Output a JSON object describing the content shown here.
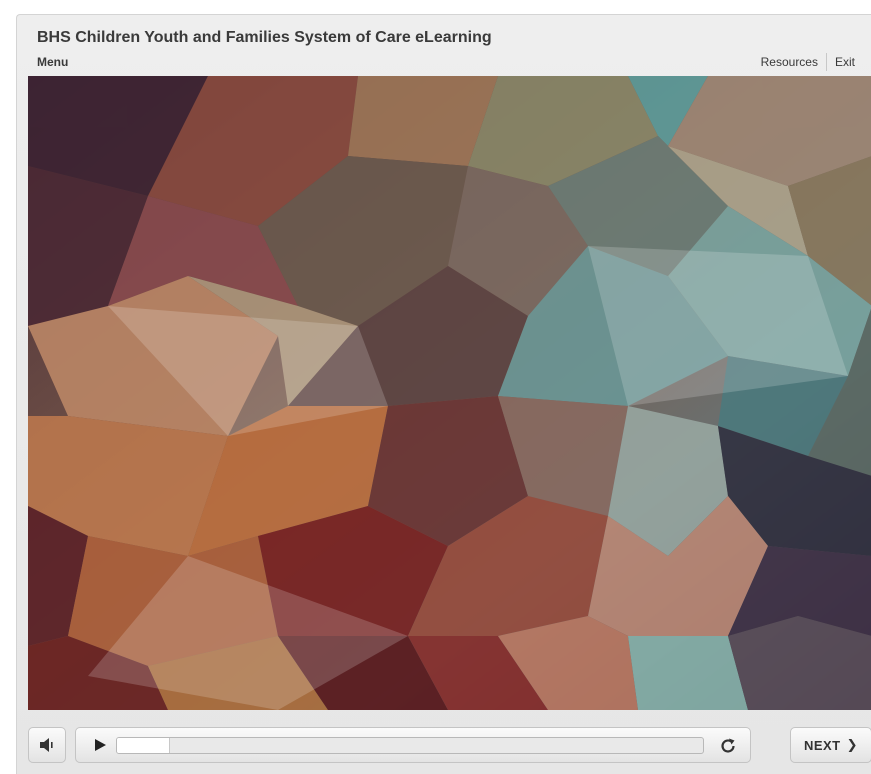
{
  "course": {
    "title": "BHS Children Youth and Families System of Care eLearning"
  },
  "nav": {
    "menu_label": "Menu",
    "resources_label": "Resources",
    "exit_label": "Exit"
  },
  "playback": {
    "progress": 0.09,
    "next_label": "NEXT",
    "icons": {
      "volume": "speaker-icon",
      "play": "play-icon",
      "replay": "replay-icon",
      "next": "chevron-right-icon"
    }
  },
  "colors": {
    "chrome_bg": "#eeeeee",
    "text": "#3a3a3a",
    "button_border": "#c4c4c4"
  }
}
